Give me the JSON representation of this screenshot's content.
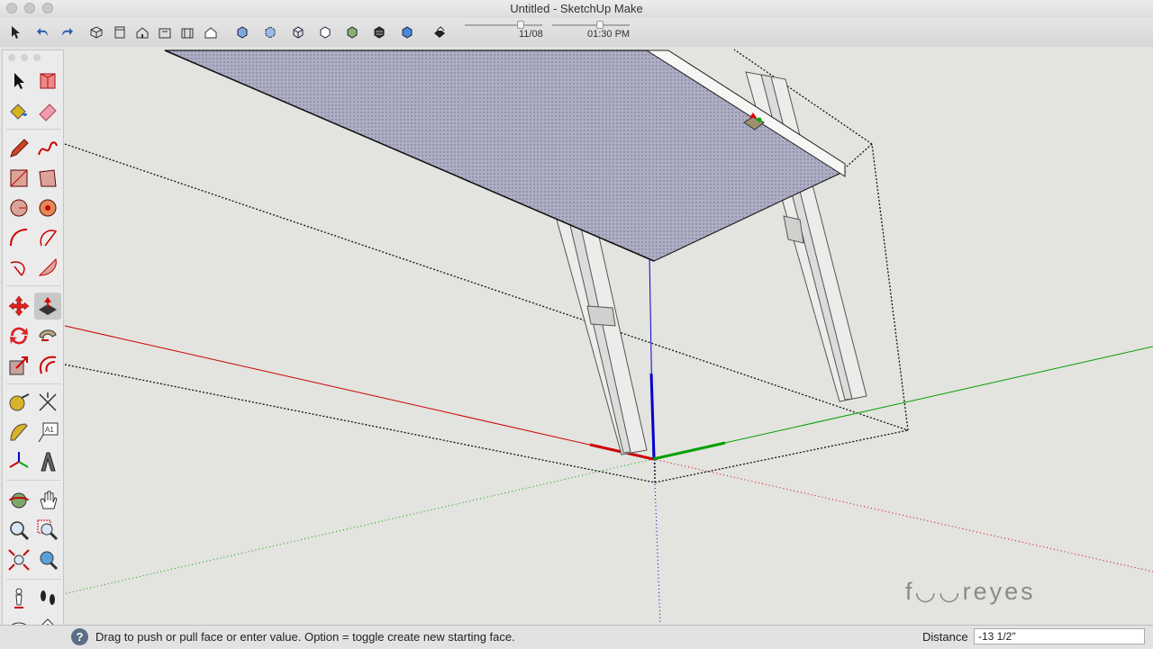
{
  "window": {
    "title": "Untitled - SketchUp Make"
  },
  "toolbar": {
    "icons": [
      "select-icon",
      "undo-icon",
      "redo-icon",
      "iso-view-icon",
      "top-view-icon",
      "front-view-icon",
      "right-view-icon",
      "back-view-icon",
      "left-view-icon",
      "xray-icon",
      "back-edges-icon",
      "wireframe-icon",
      "hidden-line-icon",
      "shaded-icon",
      "shaded-textures-icon",
      "monochrome-icon",
      "shadows-icon"
    ],
    "date_slider_label": "11/08",
    "time_slider_label": "01:30 PM",
    "date_fraction": 0.72,
    "time_fraction": 0.62
  },
  "palette": {
    "tools": [
      "select-tool",
      "make-component-tool",
      "paint-bucket-tool",
      "eraser-tool",
      "pencil-line-tool",
      "freehand-tool",
      "rectangle-tool",
      "rotated-rectangle-tool",
      "circle-tool",
      "polygon-tool",
      "arc-tool",
      "two-point-arc-tool",
      "three-point-arc-tool",
      "pie-tool",
      "move-tool",
      "push-pull-tool",
      "rotate-tool",
      "follow-me-tool",
      "scale-tool",
      "offset-tool",
      "tape-measure-tool",
      "dimension-tool",
      "protractor-tool",
      "text-tool",
      "axes-tool",
      "3d-text-tool",
      "orbit-tool",
      "pan-tool",
      "zoom-tool",
      "zoom-window-tool",
      "zoom-extents-tool",
      "previous-view-tool",
      "position-camera-tool",
      "walk-tool",
      "look-around-tool",
      "section-plane-tool"
    ],
    "active_tool": "push-pull-tool"
  },
  "watermark": "f◡◡reyes",
  "status": {
    "help_icon": "?",
    "message": "Drag to push or pull face or enter value.  Option = toggle create new starting face.",
    "measure_label": "Distance",
    "measure_value": "-13 1/2\""
  },
  "colors": {
    "x_axis": "#cc0000",
    "y_axis": "#00a000",
    "z_axis": "#0000cc",
    "face": "#a9a9bf",
    "background": "#e3e3df",
    "active_button": "#c8c8c8"
  }
}
